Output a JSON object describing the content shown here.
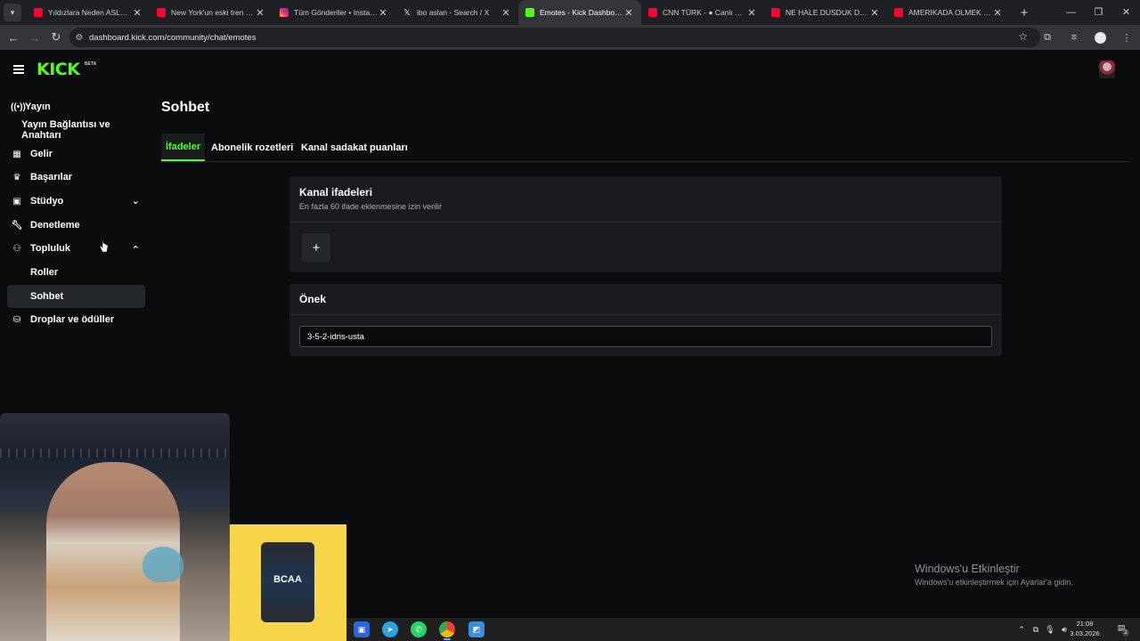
{
  "browser": {
    "tabs": [
      {
        "title": "Yıldızlara Neden ASLA Gi",
        "favicon": "youtube-icon",
        "color": "#ff0033",
        "active": false
      },
      {
        "title": "New York'un eski tren yol",
        "favicon": "youtube-icon",
        "color": "#ff0033",
        "active": false
      },
      {
        "title": "Tüm Gönderiler • Instagra",
        "favicon": "instagram-icon",
        "color": "#d6249f",
        "active": false
      },
      {
        "title": "ibo aslan - Search / X",
        "favicon": "x-icon",
        "color": "#000000",
        "active": false
      },
      {
        "title": "Emotes - Kick Dashboard",
        "favicon": "kick-icon",
        "color": "#53fc18",
        "active": true
      },
      {
        "title": "CNN TÜRK - ● Canlı Yay",
        "favicon": "youtube-icon",
        "color": "#ff0033",
        "active": false
      },
      {
        "title": "NE HALE DUSDUK DUYAN",
        "favicon": "youtube-icon",
        "color": "#ff0033",
        "active": false
      },
      {
        "title": "AMERIKADA OLMEK ICIN",
        "favicon": "youtube-icon",
        "color": "#ff0033",
        "active": false
      }
    ],
    "url": "dashboard.kick.com/community/chat/emotes"
  },
  "header": {
    "logo": "KICK",
    "logo_badge": "BETA"
  },
  "sidebar": {
    "items": [
      {
        "label": "Yayın",
        "icon": "broadcast-icon"
      },
      {
        "label": "Yayın Bağlantısı ve Anahtarı",
        "icon": ""
      },
      {
        "label": "Gelir",
        "icon": "chart-icon"
      },
      {
        "label": "Başarılar",
        "icon": "trophy-icon"
      },
      {
        "label": "Stüdyo",
        "icon": "studio-icon",
        "chevron": "down"
      },
      {
        "label": "Denetleme",
        "icon": "wrench-icon"
      },
      {
        "label": "Topluluk",
        "icon": "community-icon",
        "chevron": "up"
      },
      {
        "label": "Roller",
        "icon": ""
      },
      {
        "label": "Sohbet",
        "icon": "",
        "active": true
      },
      {
        "label": "Droplar ve ödüller",
        "icon": "drops-icon"
      }
    ]
  },
  "main": {
    "title": "Sohbet",
    "tabs": [
      {
        "label": "İfadeler",
        "active": true
      },
      {
        "label": "Abonelik rozetleri",
        "active": false
      },
      {
        "label": "Kanal sadakat puanları",
        "active": false
      }
    ],
    "emotes_card": {
      "title": "Kanal ifadeleri",
      "subtitle": "En fazla 60 ifade eklenmesine izin verilir",
      "add_label": "+"
    },
    "prefix_card": {
      "title": "Önek",
      "value": "3-5-2-idris-usta"
    }
  },
  "overlay": {
    "promo_label": "BCAA"
  },
  "watermark": {
    "title": "Windows'u Etkinleştir",
    "subtitle": "Windows'u etkinleştirmek için Ayarlar'a gidin."
  },
  "taskbar": {
    "time": "21:08",
    "date": "3.03.2026",
    "notifications": "2"
  },
  "colors": {
    "accent": "#53fc18",
    "background": "#0b0c0d",
    "card": "#191b1f"
  }
}
